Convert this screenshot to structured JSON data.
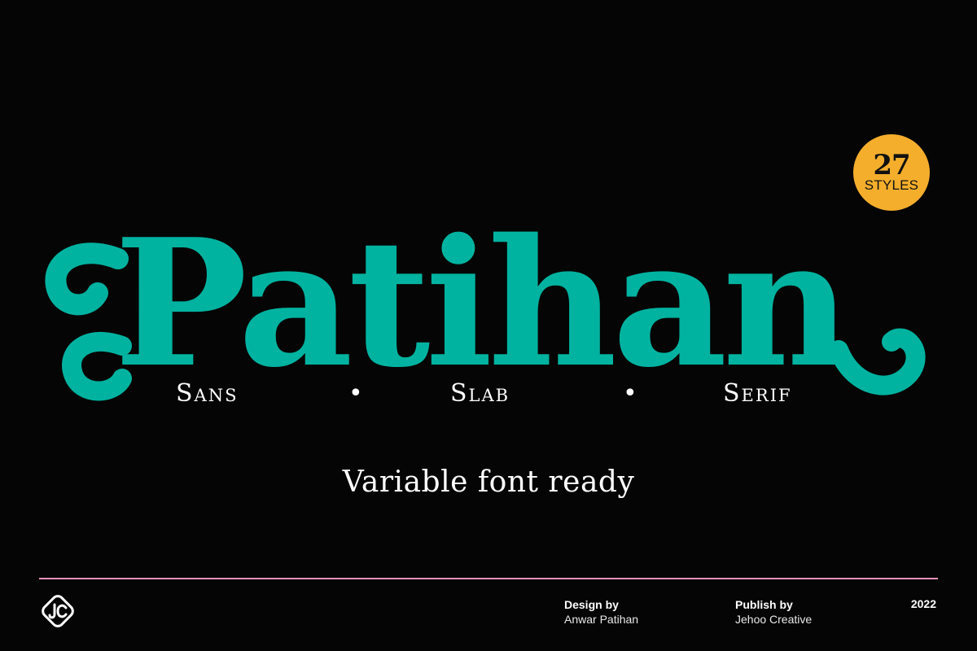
{
  "colors": {
    "background": "#050505",
    "title": "#00B3A0",
    "badge": "#F4AE2C",
    "divider": "#E792B9",
    "text": "#FFFFFF"
  },
  "title": "Patihan",
  "badge": {
    "number": "27",
    "label": "STYLES"
  },
  "styles": {
    "sans": "Sans",
    "slab": "Slab",
    "serif": "Serif",
    "separator": "•"
  },
  "tagline": "Variable font ready",
  "footer": {
    "logo_icon": "jc-monogram-icon",
    "design": {
      "label": "Design by",
      "value": "Anwar Patihan"
    },
    "publish": {
      "label": "Publish by",
      "value": "Jehoo Creative"
    },
    "year": "2022"
  }
}
